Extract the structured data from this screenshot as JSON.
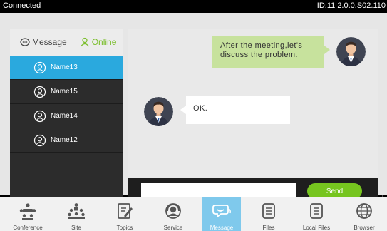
{
  "status": {
    "connection": "Connected",
    "device_info": "ID:11  2.0.0.S02.110"
  },
  "tabs": {
    "message": "Message",
    "online": "Online"
  },
  "contacts": [
    {
      "name": "Name13",
      "active": true
    },
    {
      "name": "Name15",
      "active": false
    },
    {
      "name": "Name14",
      "active": false
    },
    {
      "name": "Name12",
      "active": false
    }
  ],
  "chat": {
    "messages": [
      {
        "from": "me",
        "line1": "After the meeting,let's",
        "line2": "discuss the problem."
      },
      {
        "from": "other",
        "text": "OK."
      }
    ],
    "input_value": "",
    "send_label": "Send"
  },
  "dock": [
    {
      "label": "Conference",
      "icon": "conference-icon"
    },
    {
      "label": "Site",
      "icon": "site-icon"
    },
    {
      "label": "Topics",
      "icon": "topics-icon"
    },
    {
      "label": "Service",
      "icon": "service-icon"
    },
    {
      "label": "Message",
      "icon": "message-icon",
      "active": true
    },
    {
      "label": "Files",
      "icon": "files-icon"
    },
    {
      "label": "Local Files",
      "icon": "local-files-icon"
    },
    {
      "label": "Browser",
      "icon": "browser-icon"
    }
  ],
  "colors": {
    "accent": "#2aa9de",
    "send": "#76c51f",
    "bubble_mine": "#c7e29d",
    "online": "#7cbf2e"
  }
}
